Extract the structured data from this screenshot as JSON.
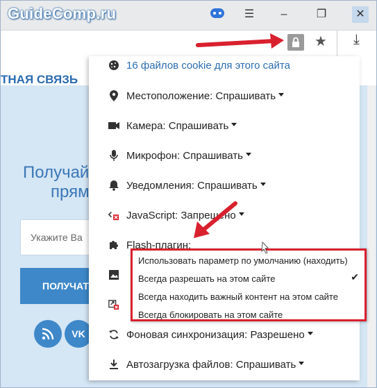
{
  "browser": {
    "site_brand": "GuideComp.ru",
    "window_buttons": {
      "menu": "☰",
      "minimize": "–",
      "restore": "❐",
      "close": "✕"
    },
    "toolbar": {
      "star": "★",
      "download": "⤓"
    }
  },
  "page": {
    "nav_text": "ТНАЯ СВЯЗЬ",
    "hero_line1": "Получай",
    "hero_line2": "прям",
    "email_placeholder": "Укажите Ва",
    "submit_label": "ПОЛУЧАТ",
    "social": {
      "rss": "RSS",
      "vk": "VK"
    }
  },
  "permissions": {
    "cookies": "16 файлов cookie для этого сайта",
    "location": "Местоположение:  Спрашивать",
    "camera": "Камера:  Спрашивать",
    "microphone": "Микрофон:  Спрашивать",
    "notifications": "Уведомления:  Спрашивать",
    "javascript": "JavaScript:  Запрещено",
    "flash": "Flash-плагин:",
    "background_sync": "Фоновая синхронизация:  Разрешено",
    "auto_download": "Автозагрузка файлов:  Спрашивать"
  },
  "flash_menu": {
    "options": [
      "Использовать параметр по умолчанию (находить)",
      "Всегда разрешать на этом сайте",
      "Всегда находить важный контент на этом сайте",
      "Всегда блокировать на этом сайте"
    ],
    "selected_index": 1
  },
  "colors": {
    "accent_red": "#d9202e",
    "link_blue": "#2b6cb0",
    "page_blue": "#d5e6f4"
  }
}
